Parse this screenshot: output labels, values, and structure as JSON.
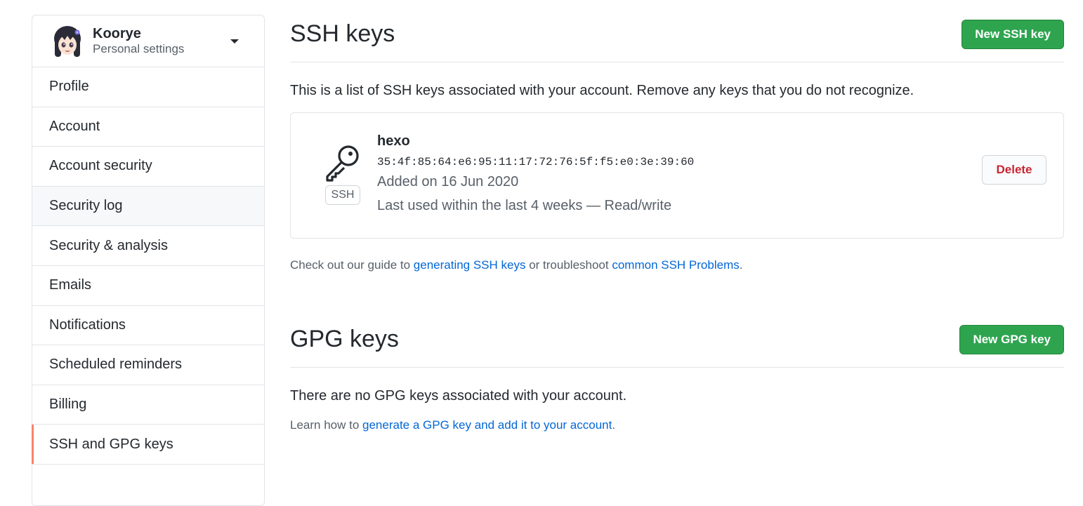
{
  "user": {
    "name": "Koorye",
    "subtitle": "Personal settings"
  },
  "sidebar": {
    "items": [
      {
        "label": "Profile"
      },
      {
        "label": "Account"
      },
      {
        "label": "Account security"
      },
      {
        "label": "Security log"
      },
      {
        "label": "Security & analysis"
      },
      {
        "label": "Emails"
      },
      {
        "label": "Notifications"
      },
      {
        "label": "Scheduled reminders"
      },
      {
        "label": "Billing"
      },
      {
        "label": "SSH and GPG keys"
      }
    ],
    "selected": "SSH and GPG keys",
    "accent_color": "#f9826c"
  },
  "ssh": {
    "title": "SSH keys",
    "new_button": "New SSH key",
    "intro": "This is a list of SSH keys associated with your account. Remove any keys that you do not recognize.",
    "key": {
      "name": "hexo",
      "fingerprint": "35:4f:85:64:e6:95:11:17:72:76:5f:f5:e0:3e:39:60",
      "added": "Added on 16 Jun 2020",
      "last_used": "Last used within the last 4 weeks — Read/write",
      "badge": "SSH",
      "icon": "key-icon",
      "delete_label": "Delete"
    },
    "guide": {
      "prefix": "Check out our guide to ",
      "link1": "generating SSH keys",
      "middle": " or troubleshoot ",
      "link2": "common SSH Problems",
      "suffix": "."
    }
  },
  "gpg": {
    "title": "GPG keys",
    "new_button": "New GPG key",
    "empty": "There are no GPG keys associated with your account.",
    "learn": {
      "prefix": "Learn how to ",
      "link": "generate a GPG key and add it to your account",
      "suffix": "."
    }
  },
  "colors": {
    "primary_button": "#2ea44f",
    "link": "#0366d6",
    "danger": "#cb2431"
  }
}
